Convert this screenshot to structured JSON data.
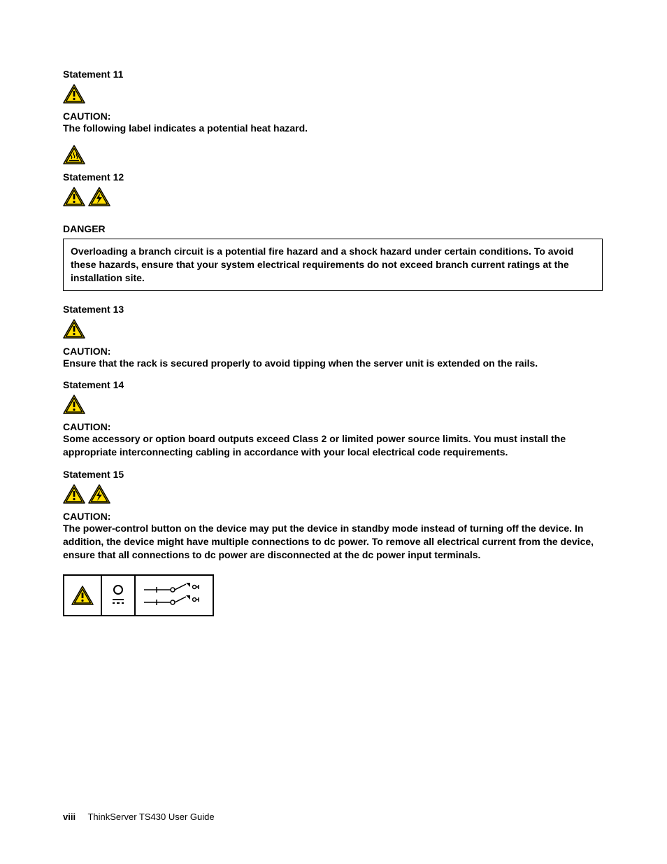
{
  "statements": {
    "s11": {
      "title": "Statement 11",
      "caution": "CAUTION:",
      "body": "The following label indicates a potential heat hazard."
    },
    "s12": {
      "title": "Statement 12",
      "danger": "DANGER",
      "box": "Overloading a branch circuit is a potential fire hazard and a shock hazard under certain conditions.  To avoid these hazards, ensure that your system electrical requirements do not exceed branch current ratings at the installation site."
    },
    "s13": {
      "title": "Statement 13",
      "caution": "CAUTION:",
      "body": "Ensure that the rack is secured properly to avoid tipping when the server unit is extended on the rails."
    },
    "s14": {
      "title": "Statement 14",
      "caution": "CAUTION:",
      "body": "Some accessory or option board outputs exceed Class 2 or limited power source limits.  You must install the appropriate interconnecting cabling in accordance with your local electrical code requirements."
    },
    "s15": {
      "title": "Statement 15",
      "caution": "CAUTION:",
      "body": "The power-control button on the device may put the device in standby mode instead of turning off the device.  In addition, the device might have multiple connections to dc power.  To remove all electrical current from the device, ensure that all connections to dc power are disconnected at the dc power input terminals."
    }
  },
  "footer": {
    "page": "viii",
    "title": "ThinkServer TS430 User Guide"
  }
}
